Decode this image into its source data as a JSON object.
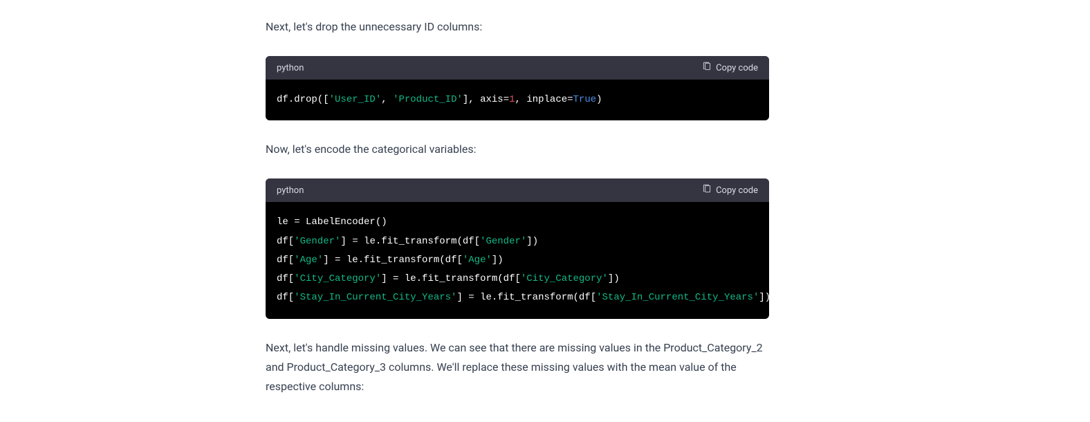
{
  "paragraphs": {
    "p1": "Next, let's drop the unnecessary ID columns:",
    "p2": "Now, let's encode the categorical variables:",
    "p3": "Next, let's handle missing values. We can see that there are missing values in the Product_Category_2 and Product_Category_3 columns. We'll replace these missing values with the mean value of the respective columns:"
  },
  "code_blocks": [
    {
      "language": "python",
      "copy_label": "Copy code",
      "tokens": [
        [
          {
            "t": "df.drop([",
            "c": "default"
          },
          {
            "t": "'User_ID'",
            "c": "string"
          },
          {
            "t": ", ",
            "c": "default"
          },
          {
            "t": "'Product_ID'",
            "c": "string"
          },
          {
            "t": "], axis=",
            "c": "default"
          },
          {
            "t": "1",
            "c": "number"
          },
          {
            "t": ", inplace=",
            "c": "default"
          },
          {
            "t": "True",
            "c": "bool"
          },
          {
            "t": ")",
            "c": "default"
          }
        ]
      ]
    },
    {
      "language": "python",
      "copy_label": "Copy code",
      "tokens": [
        [
          {
            "t": "le = LabelEncoder()",
            "c": "default"
          }
        ],
        [
          {
            "t": "df[",
            "c": "default"
          },
          {
            "t": "'Gender'",
            "c": "string"
          },
          {
            "t": "] = le.fit_transform(df[",
            "c": "default"
          },
          {
            "t": "'Gender'",
            "c": "string"
          },
          {
            "t": "])",
            "c": "default"
          }
        ],
        [
          {
            "t": "df[",
            "c": "default"
          },
          {
            "t": "'Age'",
            "c": "string"
          },
          {
            "t": "] = le.fit_transform(df[",
            "c": "default"
          },
          {
            "t": "'Age'",
            "c": "string"
          },
          {
            "t": "])",
            "c": "default"
          }
        ],
        [
          {
            "t": "df[",
            "c": "default"
          },
          {
            "t": "'City_Category'",
            "c": "string"
          },
          {
            "t": "] = le.fit_transform(df[",
            "c": "default"
          },
          {
            "t": "'City_Category'",
            "c": "string"
          },
          {
            "t": "])",
            "c": "default"
          }
        ],
        [
          {
            "t": "df[",
            "c": "default"
          },
          {
            "t": "'Stay_In_Current_City_Years'",
            "c": "string"
          },
          {
            "t": "] = le.fit_transform(df[",
            "c": "default"
          },
          {
            "t": "'Stay_In_Current_City_Years'",
            "c": "string"
          },
          {
            "t": "])",
            "c": "default"
          }
        ]
      ]
    }
  ]
}
